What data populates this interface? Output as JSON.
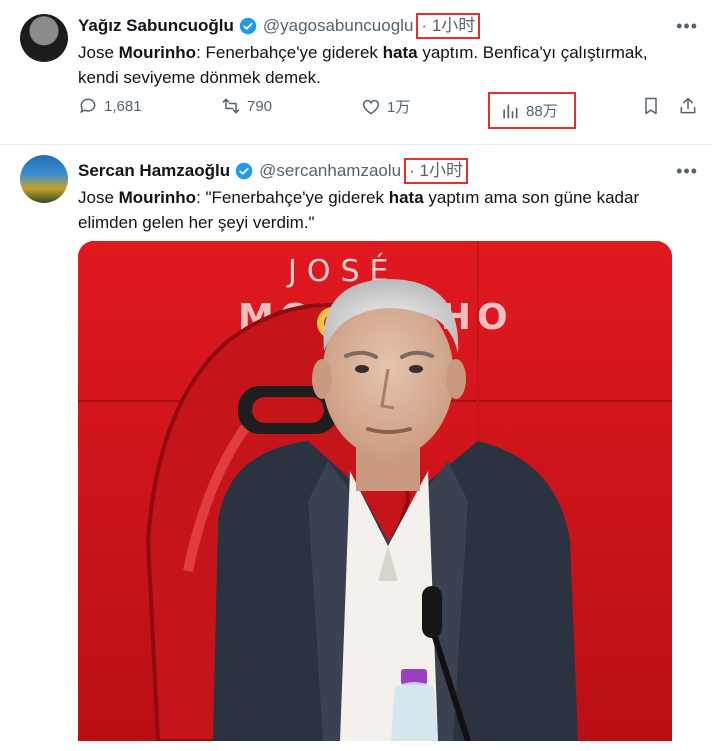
{
  "tweets": [
    {
      "name": "Yağız Sabuncuoğlu",
      "handle": "@yagosabuncuoglu",
      "separator": "·",
      "time": "1小时",
      "text_parts": [
        "Jose ",
        "Mourinho",
        ": Fenerbahçe'ye giderek ",
        "hata",
        " yaptım. Benfica'yı çalıştırmak, kendi seviyeme dönmek demek."
      ],
      "stats": {
        "replies": "1,681",
        "retweets": "790",
        "likes": "1万",
        "views": "88万"
      }
    },
    {
      "name": "Sercan Hamzaoğlu",
      "handle": "@sercanhamzaolu",
      "separator": "·",
      "time": "1小时",
      "text_parts": [
        "Jose ",
        "Mourinho",
        ": \"Fenerbahçe'ye giderek ",
        "hata",
        " yaptım ama son güne kadar elimden gelen her şeyi verdim.\""
      ],
      "media_text": {
        "line1": "JOSÉ",
        "line2": "MOURINHO"
      }
    }
  ],
  "colors": {
    "verified": "#1d9bf0",
    "highlight": "#e0322b",
    "secondary": "#536471",
    "benfica_red": "#d5161b"
  },
  "icons": [
    "verified-badge-icon",
    "more-icon",
    "reply-icon",
    "retweet-icon",
    "like-icon",
    "views-icon",
    "bookmark-icon",
    "share-icon"
  ]
}
